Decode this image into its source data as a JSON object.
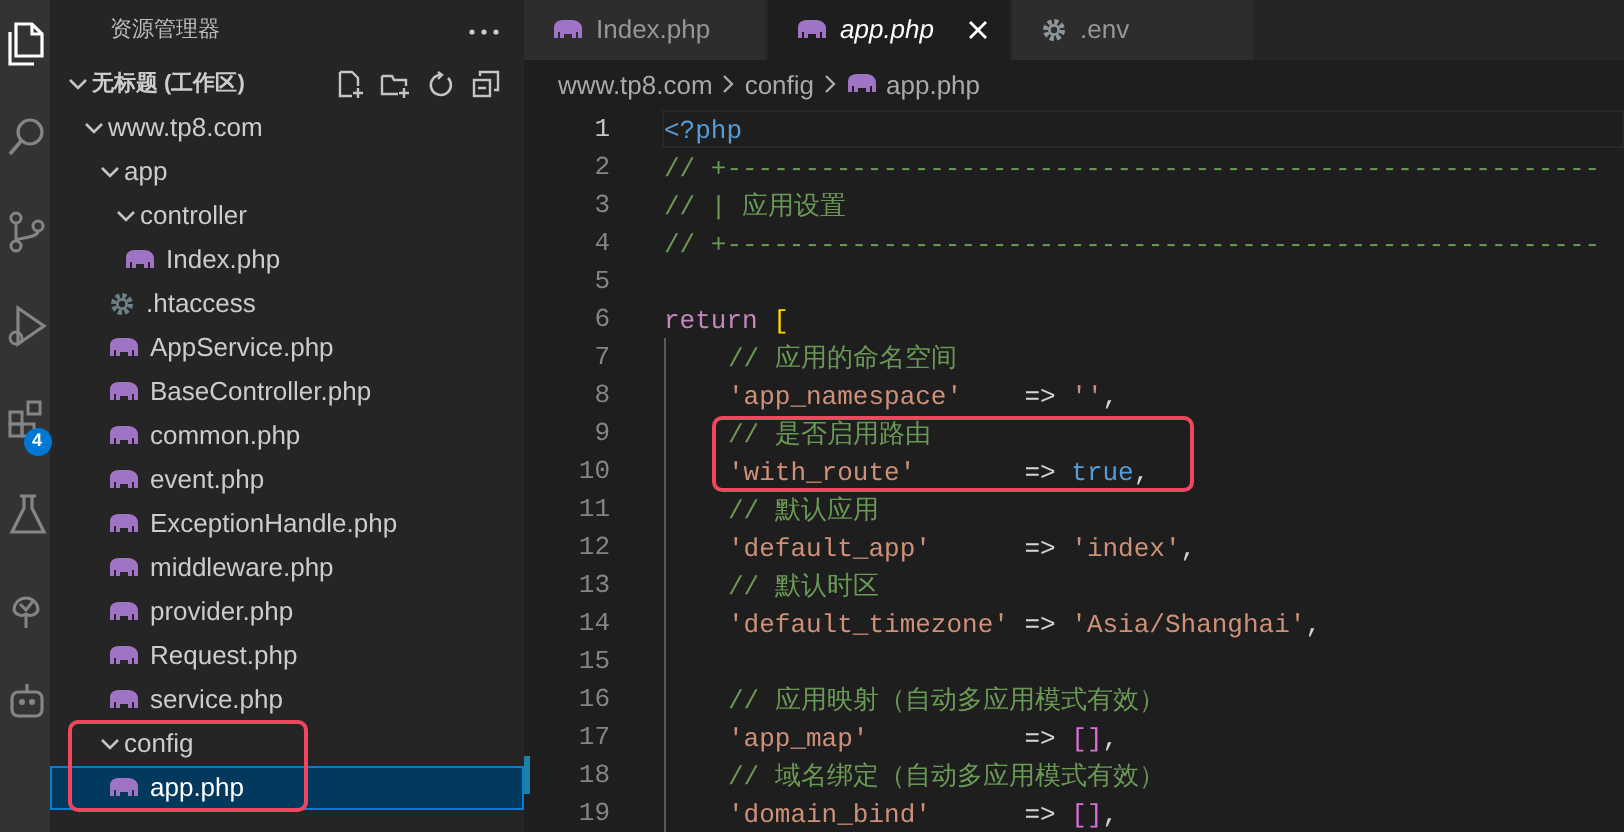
{
  "activity_bar": {
    "items": [
      {
        "kind": "files",
        "selected": true
      },
      {
        "kind": "search",
        "selected": false
      },
      {
        "kind": "source-control",
        "selected": false
      },
      {
        "kind": "run",
        "selected": false
      },
      {
        "kind": "extensions",
        "selected": false,
        "badge": "4"
      },
      {
        "kind": "testing",
        "selected": false
      },
      {
        "kind": "tree",
        "selected": false
      },
      {
        "kind": "robot",
        "selected": false
      }
    ]
  },
  "sidebar": {
    "title": "资源管理器",
    "workspace": {
      "label": "无标题 (工作区)",
      "expanded": true,
      "children": [
        {
          "label": "www.tp8.com",
          "kind": "folder",
          "expanded": true,
          "selected": false,
          "annotated": false,
          "children": [
            {
              "label": "app",
              "kind": "folder",
              "expanded": true,
              "selected": false,
              "annotated": false,
              "children": [
                {
                  "label": "controller",
                  "kind": "folder",
                  "expanded": true,
                  "selected": false,
                  "annotated": false,
                  "children": [
                    {
                      "label": "Index.php",
                      "kind": "php",
                      "selected": false,
                      "annotated": false
                    }
                  ]
                },
                {
                  "label": ".htaccess",
                  "kind": "config",
                  "selected": false,
                  "annotated": false
                },
                {
                  "label": "AppService.php",
                  "kind": "php",
                  "selected": false,
                  "annotated": false
                },
                {
                  "label": "BaseController.php",
                  "kind": "php",
                  "selected": false,
                  "annotated": false
                },
                {
                  "label": "common.php",
                  "kind": "php",
                  "selected": false,
                  "annotated": false
                },
                {
                  "label": "event.php",
                  "kind": "php",
                  "selected": false,
                  "annotated": false
                },
                {
                  "label": "ExceptionHandle.php",
                  "kind": "php",
                  "selected": false,
                  "annotated": false
                },
                {
                  "label": "middleware.php",
                  "kind": "php",
                  "selected": false,
                  "annotated": false
                },
                {
                  "label": "provider.php",
                  "kind": "php",
                  "selected": false,
                  "annotated": false
                },
                {
                  "label": "Request.php",
                  "kind": "php",
                  "selected": false,
                  "annotated": false
                },
                {
                  "label": "service.php",
                  "kind": "php",
                  "selected": false,
                  "annotated": false
                }
              ]
            },
            {
              "label": "config",
              "kind": "folder",
              "expanded": true,
              "selected": false,
              "annotated": true,
              "children": [
                {
                  "label": "app.php",
                  "kind": "php",
                  "selected": true,
                  "annotated": true
                }
              ]
            }
          ]
        }
      ]
    }
  },
  "tabs": [
    {
      "label": "Index.php",
      "kind": "php",
      "selected": false,
      "preview": false
    },
    {
      "label": "app.php",
      "kind": "php",
      "selected": true,
      "preview": true
    },
    {
      "label": ".env",
      "kind": "config",
      "selected": false,
      "preview": false
    }
  ],
  "breadcrumb": [
    {
      "label": "www.tp8.com",
      "kind": "folder"
    },
    {
      "label": "config",
      "kind": "folder"
    },
    {
      "label": "app.php",
      "kind": "php"
    }
  ],
  "code_lines": [
    {
      "n": "1",
      "indented": false,
      "current": true,
      "modified": false,
      "annotated": false,
      "tokens": [
        {
          "kind": "tag",
          "text": "<?php"
        }
      ]
    },
    {
      "n": "2",
      "indented": false,
      "current": false,
      "modified": false,
      "annotated": false,
      "tokens": [
        {
          "kind": "comment",
          "text": "// +--------------------------------------------------------"
        }
      ]
    },
    {
      "n": "3",
      "indented": false,
      "current": false,
      "modified": false,
      "annotated": false,
      "tokens": [
        {
          "kind": "comment",
          "text": "// | 应用设置"
        }
      ]
    },
    {
      "n": "4",
      "indented": false,
      "current": false,
      "modified": false,
      "annotated": false,
      "tokens": [
        {
          "kind": "comment",
          "text": "// +--------------------------------------------------------"
        }
      ]
    },
    {
      "n": "5",
      "indented": false,
      "current": false,
      "modified": false,
      "annotated": false
    },
    {
      "n": "6",
      "indented": false,
      "current": false,
      "modified": false,
      "annotated": false,
      "tokens": [
        {
          "kind": "keyword",
          "text": "return"
        },
        {
          "kind": "bracket",
          "text": " ["
        }
      ]
    },
    {
      "n": "7",
      "indented": true,
      "current": false,
      "modified": false,
      "annotated": false,
      "tokens": [
        {
          "kind": "comment",
          "text": "// 应用的命名空间"
        }
      ]
    },
    {
      "n": "8",
      "indented": true,
      "current": false,
      "modified": false,
      "annotated": false,
      "tokens": [
        {
          "kind": "string",
          "text": "'app_namespace'"
        },
        {
          "kind": "operator",
          "text": "    => "
        },
        {
          "kind": "string",
          "text": "''"
        },
        {
          "kind": "operator",
          "text": ","
        }
      ]
    },
    {
      "n": "9",
      "indented": true,
      "current": false,
      "modified": false,
      "annotated": true,
      "tokens": [
        {
          "kind": "comment",
          "text": "// 是否启用路由"
        }
      ]
    },
    {
      "n": "10",
      "indented": true,
      "current": false,
      "modified": false,
      "annotated": true,
      "tokens": [
        {
          "kind": "string",
          "text": "'with_route'"
        },
        {
          "kind": "operator",
          "text": "       => "
        },
        {
          "kind": "bool",
          "text": "true"
        },
        {
          "kind": "operator",
          "text": ","
        }
      ]
    },
    {
      "n": "11",
      "indented": true,
      "current": false,
      "modified": false,
      "annotated": false,
      "tokens": [
        {
          "kind": "comment",
          "text": "// 默认应用"
        }
      ]
    },
    {
      "n": "12",
      "indented": true,
      "current": false,
      "modified": false,
      "annotated": false,
      "tokens": [
        {
          "kind": "string",
          "text": "'default_app'"
        },
        {
          "kind": "operator",
          "text": "      => "
        },
        {
          "kind": "string",
          "text": "'index'"
        },
        {
          "kind": "operator",
          "text": ","
        }
      ]
    },
    {
      "n": "13",
      "indented": true,
      "current": false,
      "modified": false,
      "annotated": false,
      "tokens": [
        {
          "kind": "comment",
          "text": "// 默认时区"
        }
      ]
    },
    {
      "n": "14",
      "indented": true,
      "current": false,
      "modified": false,
      "annotated": false,
      "tokens": [
        {
          "kind": "string",
          "text": "'default_timezone'"
        },
        {
          "kind": "operator",
          "text": " => "
        },
        {
          "kind": "string",
          "text": "'Asia/Shanghai'"
        },
        {
          "kind": "operator",
          "text": ","
        }
      ]
    },
    {
      "n": "15",
      "indented": true,
      "current": false,
      "modified": false,
      "annotated": false
    },
    {
      "n": "16",
      "indented": true,
      "current": false,
      "modified": false,
      "annotated": false,
      "tokens": [
        {
          "kind": "comment",
          "text": "// 应用映射（自动多应用模式有效）"
        }
      ]
    },
    {
      "n": "17",
      "indented": true,
      "current": false,
      "modified": false,
      "annotated": false,
      "tokens": [
        {
          "kind": "string",
          "text": "'app_map'"
        },
        {
          "kind": "operator",
          "text": "          => "
        },
        {
          "kind": "array",
          "text": "[]"
        },
        {
          "kind": "operator",
          "text": ","
        }
      ]
    },
    {
      "n": "18",
      "indented": true,
      "current": false,
      "modified": true,
      "annotated": false,
      "tokens": [
        {
          "kind": "comment",
          "text": "// 域名绑定（自动多应用模式有效）"
        }
      ]
    },
    {
      "n": "19",
      "indented": true,
      "current": false,
      "modified": false,
      "annotated": false,
      "tokens": [
        {
          "kind": "string",
          "text": "'domain_bind'"
        },
        {
          "kind": "operator",
          "text": "      => "
        },
        {
          "kind": "array",
          "text": "[]"
        },
        {
          "kind": "operator",
          "text": ","
        }
      ]
    }
  ]
}
